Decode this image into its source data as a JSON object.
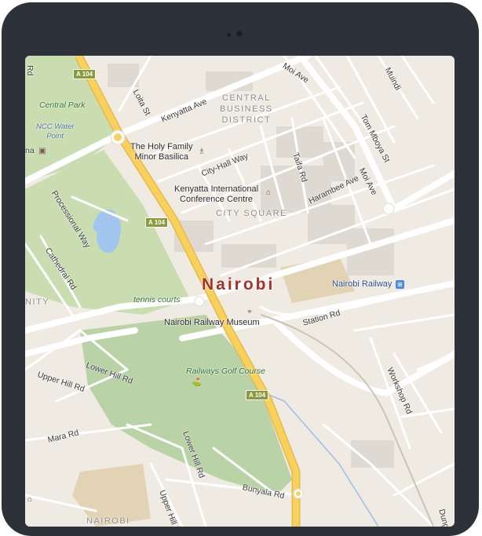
{
  "map": {
    "city": "Nairobi",
    "district": [
      "CENTRAL",
      "BUSINESS",
      "DISTRICT"
    ],
    "city_square": "CITY SQUARE",
    "road_shields": [
      "A 104",
      "A 104",
      "A 104"
    ],
    "places": {
      "central_park": "Central Park",
      "ncc_water_point": [
        "NCC Water",
        "Point"
      ],
      "holy_family": [
        "The Holy Family",
        "Minor Basilica"
      ],
      "kicc": [
        "Kenyatta International",
        "Conference Centre"
      ],
      "tennis_courts": "tennis courts",
      "railway_museum": "Nairobi Railway Museum",
      "nairobi_railway": "Nairobi Railway",
      "golf_course": "Railways Golf Course",
      "nairobi_bottom": "NAIROBI",
      "unity": "NITY",
      "na": "na"
    },
    "roads": {
      "moi_ave_top": "Moi Ave",
      "muindi": "Muindi",
      "loita": "Loita St",
      "kenyatta": "Kenyatta Ave",
      "tom_mboya": "Tom Mboya St",
      "moi_ave": "Moi Ave",
      "city_hall": "City-Hall Way",
      "taifa": "Taifa Rd",
      "harambee": "Harambee Ave",
      "processional": "Processional Way",
      "cathedral": "Cathedral Rd",
      "station": "Station Rd",
      "lower_hill_1": "Lower Hill Rd",
      "upper_hill_1": "Upper Hill Rd",
      "workshop": "Workshop Rd",
      "mara": "Mara Rd",
      "lower_hill_2": "Lower Hill Rd",
      "upper_hill_2": "Upper Hill Rd",
      "bunyala": "Bunyala Rd",
      "dung": "Dung",
      "left_rd": "Rd"
    }
  }
}
